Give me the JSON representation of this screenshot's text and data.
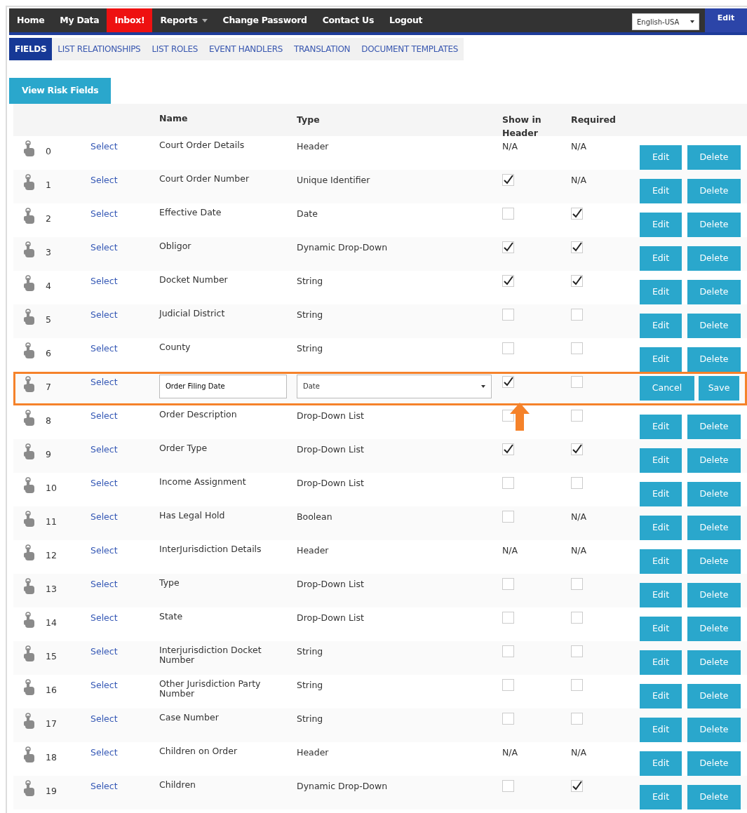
{
  "nav": {
    "items": [
      {
        "label": "Home",
        "alert": false,
        "dropdown": false
      },
      {
        "label": "My Data",
        "alert": false,
        "dropdown": false
      },
      {
        "label": "Inbox!",
        "alert": true,
        "dropdown": false
      },
      {
        "label": "Reports",
        "alert": false,
        "dropdown": true
      },
      {
        "label": "Change Password",
        "alert": false,
        "dropdown": false
      },
      {
        "label": "Contact Us",
        "alert": false,
        "dropdown": false
      },
      {
        "label": "Logout",
        "alert": false,
        "dropdown": false
      }
    ],
    "language": "English-USA",
    "edit": "Edit"
  },
  "tabs": [
    {
      "label": "FIELDS",
      "selected": true
    },
    {
      "label": "LIST RELATIONSHIPS",
      "selected": false
    },
    {
      "label": "LIST ROLES",
      "selected": false
    },
    {
      "label": "EVENT HANDLERS",
      "selected": false
    },
    {
      "label": "TRANSLATION",
      "selected": false
    },
    {
      "label": "DOCUMENT TEMPLATES",
      "selected": false
    }
  ],
  "view_risk_button": "View Risk Fields",
  "table": {
    "pointer_arrow": true,
    "columns": [
      "Name",
      "Type",
      "Show in Header",
      "Required"
    ],
    "rows": [
      {
        "kind": "view",
        "number": "0",
        "select": "Select",
        "name": "Court Order Details",
        "type": "Header",
        "show": "N/A",
        "required": "N/A",
        "buttons": [
          "Edit",
          "Delete"
        ]
      },
      {
        "kind": "view",
        "number": "1",
        "select": "Select",
        "name": "Court Order Number",
        "type": "Unique Identifier",
        "show": true,
        "required": "N/A",
        "buttons": [
          "Edit",
          "Delete"
        ]
      },
      {
        "kind": "view",
        "number": "2",
        "select": "Select",
        "name": "Effective Date",
        "type": "Date",
        "show": false,
        "required": true,
        "buttons": [
          "Edit",
          "Delete"
        ]
      },
      {
        "kind": "view",
        "number": "3",
        "select": "Select",
        "name": "Obligor",
        "type": "Dynamic Drop-Down",
        "show": true,
        "required": true,
        "buttons": [
          "Edit",
          "Delete"
        ]
      },
      {
        "kind": "view",
        "number": "4",
        "select": "Select",
        "name": "Docket Number",
        "type": "String",
        "show": true,
        "required": true,
        "buttons": [
          "Edit",
          "Delete"
        ]
      },
      {
        "kind": "view",
        "number": "5",
        "select": "Select",
        "name": "Judicial District",
        "type": "String",
        "show": false,
        "required": false,
        "buttons": [
          "Edit",
          "Delete"
        ]
      },
      {
        "kind": "view",
        "number": "6",
        "select": "Select",
        "name": "County",
        "type": "String",
        "show": false,
        "required": false,
        "buttons": [
          "Edit",
          "Delete"
        ]
      },
      {
        "kind": "edit",
        "number": "7",
        "select": "Select",
        "name": "Order Filing Date",
        "type": "Date",
        "show": true,
        "required": false,
        "buttons": [
          "Cancel",
          "Save"
        ],
        "highlighted": true
      },
      {
        "kind": "view",
        "number": "8",
        "select": "Select",
        "name": "Order Description",
        "type": "Drop-Down List",
        "show": false,
        "required": false,
        "buttons": [
          "Edit",
          "Delete"
        ]
      },
      {
        "kind": "view",
        "number": "9",
        "select": "Select",
        "name": "Order Type",
        "type": "Drop-Down List",
        "show": true,
        "required": true,
        "buttons": [
          "Edit",
          "Delete"
        ]
      },
      {
        "kind": "view",
        "number": "10",
        "select": "Select",
        "name": "Income Assignment",
        "type": "Drop-Down List",
        "show": false,
        "required": false,
        "buttons": [
          "Edit",
          "Delete"
        ]
      },
      {
        "kind": "view",
        "number": "11",
        "select": "Select",
        "name": "Has Legal Hold",
        "type": "Boolean",
        "show": false,
        "required": "N/A",
        "buttons": [
          "Edit",
          "Delete"
        ]
      },
      {
        "kind": "view",
        "number": "12",
        "select": "Select",
        "name": "InterJurisdiction Details",
        "type": "Header",
        "show": "N/A",
        "required": "N/A",
        "buttons": [
          "Edit",
          "Delete"
        ]
      },
      {
        "kind": "view",
        "number": "13",
        "select": "Select",
        "name": "Type",
        "type": "Drop-Down List",
        "show": false,
        "required": false,
        "buttons": [
          "Edit",
          "Delete"
        ]
      },
      {
        "kind": "view",
        "number": "14",
        "select": "Select",
        "name": "State",
        "type": "Drop-Down List",
        "show": false,
        "required": false,
        "buttons": [
          "Edit",
          "Delete"
        ]
      },
      {
        "kind": "view",
        "number": "15",
        "select": "Select",
        "name": "Interjurisdiction Docket Number",
        "type": "String",
        "show": false,
        "required": false,
        "buttons": [
          "Edit",
          "Delete"
        ]
      },
      {
        "kind": "view",
        "number": "16",
        "select": "Select",
        "name": "Other Jurisdiction Party Number",
        "type": "String",
        "show": false,
        "required": false,
        "buttons": [
          "Edit",
          "Delete"
        ]
      },
      {
        "kind": "view",
        "number": "17",
        "select": "Select",
        "name": "Case Number",
        "type": "String",
        "show": false,
        "required": false,
        "buttons": [
          "Edit",
          "Delete"
        ]
      },
      {
        "kind": "view",
        "number": "18",
        "select": "Select",
        "name": "Children on Order",
        "type": "Header",
        "show": "N/A",
        "required": "N/A",
        "buttons": [
          "Edit",
          "Delete"
        ]
      },
      {
        "kind": "view",
        "number": "19",
        "select": "Select",
        "name": "Children",
        "type": "Dynamic Drop-Down",
        "show": false,
        "required": true,
        "buttons": [
          "Edit",
          "Delete"
        ]
      }
    ]
  }
}
